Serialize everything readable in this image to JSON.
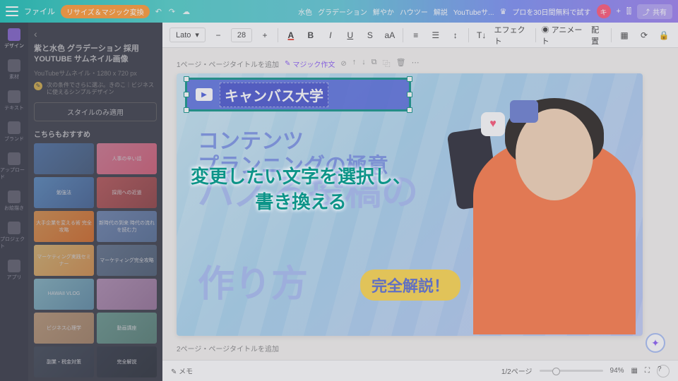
{
  "topbar": {
    "file": "ファイル",
    "resize": "リサイズ＆マジック変換",
    "tags": [
      "水色",
      "グラデーション",
      "鮮やか",
      "ハウツー",
      "解説",
      "YouTubeサ..."
    ],
    "trial": "プロを30日間無料で試す",
    "avatar": "キ",
    "share": "共有"
  },
  "rail": {
    "items": [
      {
        "label": "デザイン"
      },
      {
        "label": "素材"
      },
      {
        "label": "テキスト"
      },
      {
        "label": "ブランド"
      },
      {
        "label": "アップロード"
      },
      {
        "label": "お絵描き"
      },
      {
        "label": "プロジェクト"
      },
      {
        "label": "アプリ"
      }
    ]
  },
  "sidebar": {
    "title": "紫と水色 グラデーション 採用 YOUTUBE サムネイル画像",
    "meta": "YouTubeサムネイル・1280 x 720 px",
    "tip": "次の条件でさらに選ぶ。きのこ｜ビジネスに使えるシンプルデザイン",
    "style_btn": "スタイルのみ適用",
    "section": "こちらもおすすめ",
    "thumbs": [
      "",
      "人事の辛い話",
      "勉強法",
      "採用への近道",
      "大手企業を変える術 完全攻略",
      "新時代の到来 時代の流れを読む力",
      "マーケティング実践セミナー",
      "マーケティング完全攻略",
      "HAWAII VLOG",
      "",
      "ビジネス心理学",
      "動画講座",
      "副業・税金対策",
      "完全解説"
    ]
  },
  "toolbar": {
    "font": "Lato",
    "size": "28",
    "effects": "エフェクト",
    "animate": "アニメート",
    "position": "配置"
  },
  "page": {
    "label1": "1ページ・ページタイトルを追加",
    "magic": "マジック作文",
    "label2": "2ページ・ページタイトルを追加"
  },
  "canvas": {
    "selected_text": "キャンバス大学",
    "line1": "コンテンツ\nプランニングの極意",
    "line2": "バズる投稿の",
    "line3": "作り方",
    "badge": "完全解説！"
  },
  "overlay": {
    "instruction": "変更したい文字を選択し、\n書き換える"
  },
  "footer": {
    "notes": "メモ",
    "page": "1/2ページ",
    "zoom": "94%"
  }
}
